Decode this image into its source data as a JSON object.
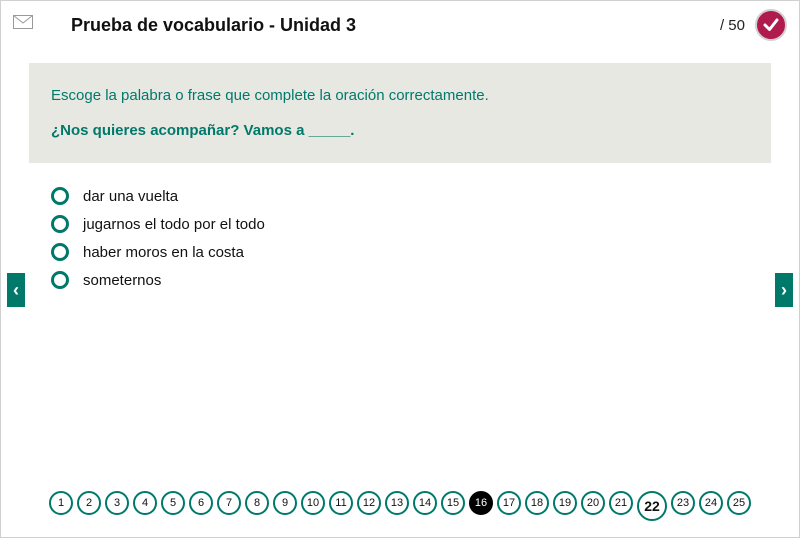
{
  "header": {
    "title": "Prueba de vocabulario - Unidad 3",
    "score": "/ 50"
  },
  "prompt": {
    "instruction": "Escoge la palabra o frase que complete la oración correctamente.",
    "question": "¿Nos quieres acompañar?  Vamos a _____."
  },
  "options": [
    {
      "label": "dar una vuelta"
    },
    {
      "label": "jugarnos el todo por el todo"
    },
    {
      "label": "haber moros en la costa"
    },
    {
      "label": "someternos"
    }
  ],
  "nav": {
    "prev_glyph": "‹",
    "next_glyph": "›"
  },
  "pager": {
    "total_visible": 25,
    "active": 16,
    "current": 22,
    "labels": [
      "1",
      "2",
      "3",
      "4",
      "5",
      "6",
      "7",
      "8",
      "9",
      "10",
      "11",
      "12",
      "13",
      "14",
      "15",
      "16",
      "17",
      "18",
      "19",
      "20",
      "21",
      "22",
      "23",
      "24",
      "25"
    ]
  }
}
